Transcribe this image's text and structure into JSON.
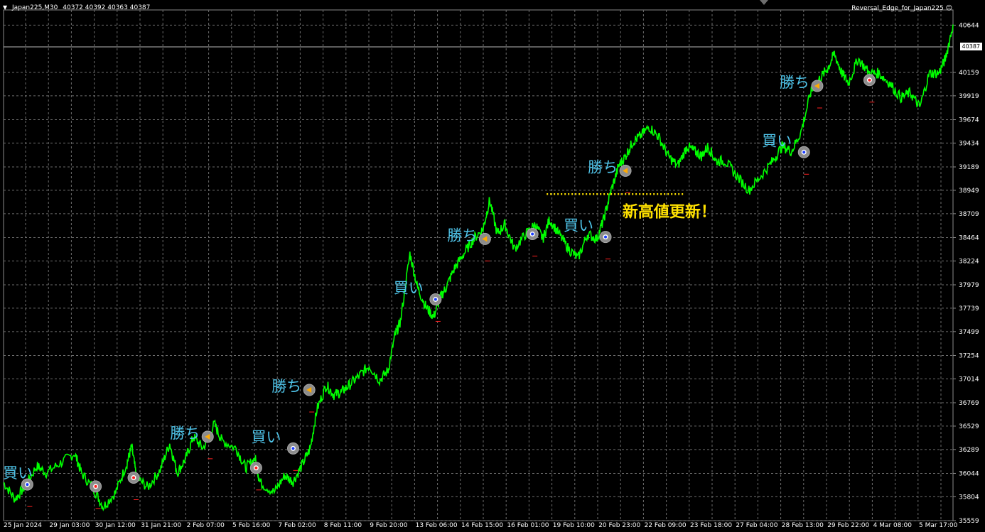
{
  "header": {
    "symbol": "Japan225,M30",
    "ohlc": "40372 40392 40363 40387",
    "indicator": "Reversal_Edge_for_Japan225",
    "indicator_icon": "smiley-icon"
  },
  "current_price_label": "40387",
  "colors": {
    "background": "#000000",
    "grid": "#6d6d6d",
    "price_line": "#00ff00",
    "buy_label": "#4fc3e8",
    "annotation": "#ffe100",
    "axis_text": "#ffffff"
  },
  "chart_data": {
    "type": "line",
    "ylim": [
      35559,
      40800
    ],
    "grid": true,
    "y_ticks": [
      40644,
      40159,
      39919,
      39674,
      39434,
      39189,
      38949,
      38709,
      38464,
      38224,
      37979,
      37739,
      37499,
      37254,
      37014,
      36769,
      36529,
      36289,
      36044,
      35804,
      35559
    ],
    "x_ticks": [
      "25 Jan 2024",
      "29 Jan 03:00",
      "30 Jan 12:00",
      "31 Jan 21:00",
      "2 Feb 07:00",
      "5 Feb 16:00",
      "7 Feb 02:00",
      "8 Feb 11:00",
      "9 Feb 20:00",
      "13 Feb 06:00",
      "14 Feb 15:00",
      "16 Feb 01:00",
      "19 Feb 10:00",
      "20 Feb 23:00",
      "22 Feb 09:00",
      "23 Feb 18:00",
      "27 Feb 04:00",
      "28 Feb 13:00",
      "29 Feb 22:00",
      "4 Mar 08:00",
      "5 Mar 17:00"
    ],
    "series": [
      {
        "x": [
          0,
          0.012,
          0.022,
          0.035,
          0.045,
          0.06,
          0.075,
          0.082,
          0.095,
          0.105,
          0.118,
          0.13,
          0.135,
          0.14,
          0.152,
          0.165,
          0.175,
          0.183,
          0.192,
          0.2,
          0.21,
          0.222,
          0.23,
          0.245,
          0.255,
          0.265,
          0.27,
          0.285,
          0.296,
          0.305,
          0.314,
          0.323,
          0.33,
          0.34,
          0.348,
          0.356,
          0.364,
          0.375,
          0.385,
          0.396,
          0.405,
          0.412,
          0.418,
          0.428,
          0.436,
          0.445,
          0.453,
          0.46,
          0.466,
          0.475,
          0.485,
          0.495,
          0.505,
          0.512,
          0.52,
          0.528,
          0.538,
          0.55,
          0.56,
          0.568,
          0.575,
          0.585,
          0.595,
          0.605,
          0.615,
          0.625,
          0.632,
          0.64,
          0.648,
          0.655,
          0.663,
          0.67,
          0.68,
          0.69,
          0.7,
          0.71,
          0.72,
          0.728,
          0.735,
          0.742,
          0.75,
          0.76,
          0.772,
          0.785,
          0.798,
          0.81,
          0.82,
          0.83,
          0.84,
          0.85,
          0.86,
          0.868,
          0.875,
          0.883,
          0.89,
          0.9,
          0.912,
          0.922,
          0.933,
          0.945,
          0.955,
          0.965,
          0.975,
          0.985,
          0.992,
          1.0
        ],
        "y": [
          35950,
          35780,
          35900,
          36120,
          36050,
          36150,
          36250,
          36050,
          35880,
          35700,
          35850,
          36150,
          36320,
          36000,
          35900,
          36080,
          36350,
          36050,
          36200,
          36420,
          36300,
          36550,
          36380,
          36300,
          36100,
          36200,
          35950,
          35850,
          36020,
          35960,
          36120,
          36300,
          36700,
          36950,
          36850,
          36880,
          36950,
          37050,
          37150,
          37000,
          37100,
          37450,
          37600,
          38300,
          37950,
          37750,
          37650,
          37850,
          37950,
          38150,
          38300,
          38450,
          38550,
          38850,
          38500,
          38600,
          38350,
          38500,
          38600,
          38450,
          38650,
          38500,
          38350,
          38250,
          38500,
          38450,
          38650,
          38950,
          39200,
          39300,
          39450,
          39500,
          39600,
          39500,
          39300,
          39200,
          39400,
          39350,
          39300,
          39400,
          39250,
          39250,
          39100,
          38950,
          39100,
          39250,
          39400,
          39350,
          39550,
          39950,
          40100,
          40200,
          40350,
          40150,
          40050,
          40300,
          40150,
          40150,
          40050,
          39900,
          39950,
          39800,
          40150,
          40150,
          40300,
          40650
        ]
      }
    ],
    "annotations": [
      {
        "text": "買い",
        "kind": "buy"
      },
      {
        "text": "勝ち",
        "kind": "win"
      },
      {
        "text": "新高値更新！",
        "kind": "highlight"
      }
    ],
    "markers": [
      {
        "time": 0.025,
        "price": 35930,
        "type": "buy-entry",
        "label": "買い"
      },
      {
        "time": 0.097,
        "price": 35910,
        "type": "sell-exit"
      },
      {
        "time": 0.137,
        "price": 36000,
        "type": "sell-exit"
      },
      {
        "time": 0.215,
        "price": 36420,
        "type": "win-exit",
        "label": "勝ち"
      },
      {
        "time": 0.266,
        "price": 36100,
        "type": "sell-exit"
      },
      {
        "time": 0.305,
        "price": 36300,
        "type": "buy-entry",
        "label": "買い"
      },
      {
        "time": 0.322,
        "price": 36900,
        "type": "win-exit",
        "label": "勝ち"
      },
      {
        "time": 0.455,
        "price": 37830,
        "type": "buy-entry",
        "label": "買い"
      },
      {
        "time": 0.507,
        "price": 38450,
        "type": "win-exit",
        "label": "勝ち"
      },
      {
        "time": 0.557,
        "price": 38500,
        "type": "buy-entry"
      },
      {
        "time": 0.634,
        "price": 38470,
        "type": "buy-entry",
        "label": "買い"
      },
      {
        "time": 0.655,
        "price": 39150,
        "type": "win-exit",
        "label": "勝ち"
      },
      {
        "time": 0.843,
        "price": 39340,
        "type": "buy-entry",
        "label": "買い"
      },
      {
        "time": 0.857,
        "price": 40020,
        "type": "win-exit",
        "label": "勝ち"
      },
      {
        "time": 0.912,
        "price": 40080,
        "type": "sell-exit"
      }
    ],
    "new_high_line": {
      "price": 38910,
      "from": 0.572,
      "to": 0.717
    }
  }
}
